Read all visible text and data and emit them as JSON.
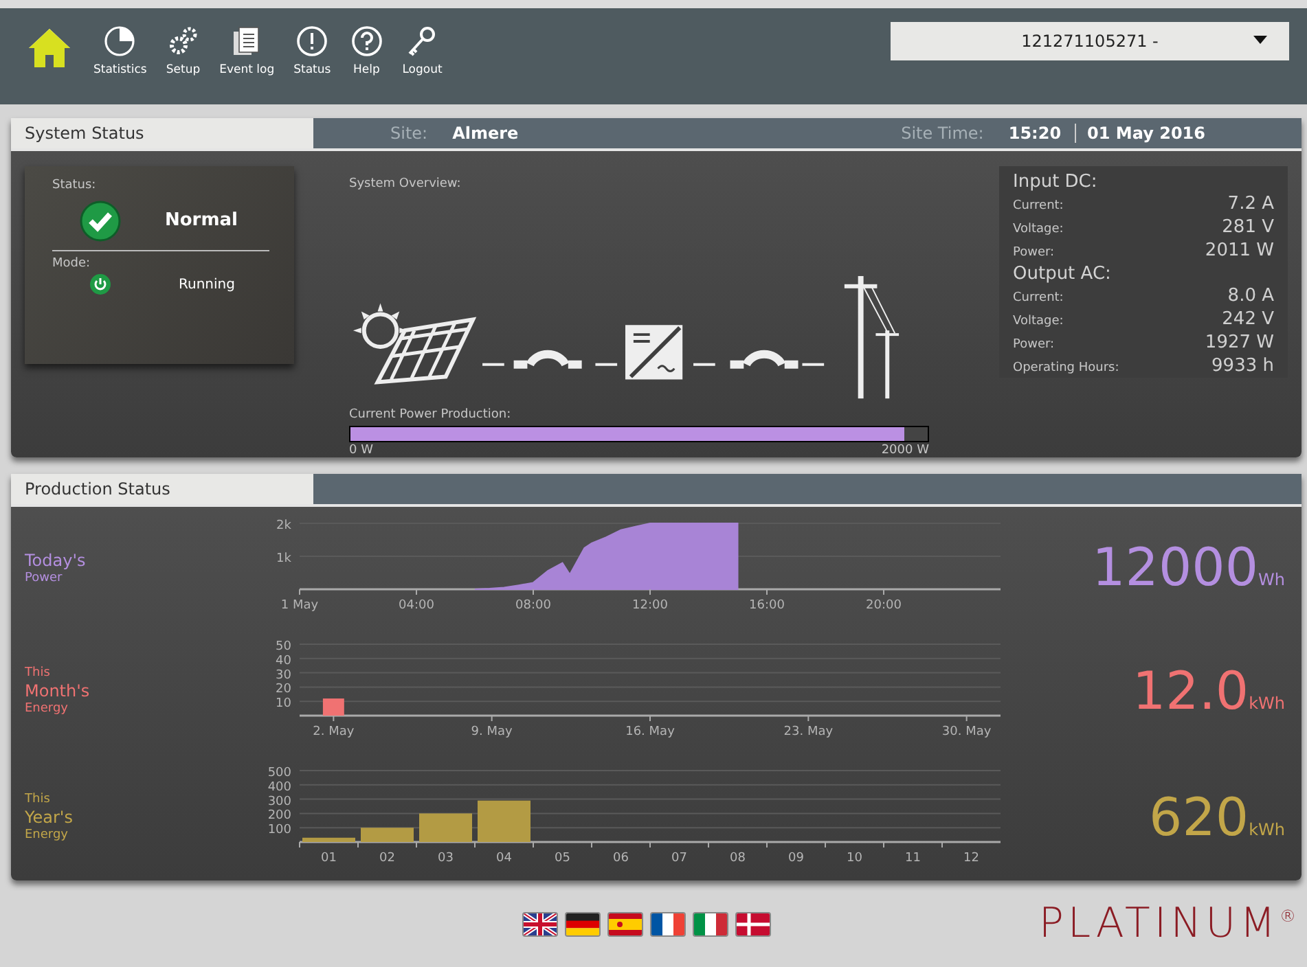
{
  "nav": [
    {
      "kind": "home",
      "selected": true
    },
    {
      "kind": "chart",
      "label": "Statistics",
      "selected": false
    },
    {
      "kind": "gears",
      "label": "Setup",
      "selected": false
    },
    {
      "kind": "document",
      "label": "Event log",
      "selected": false
    },
    {
      "kind": "alert",
      "label": "Status",
      "selected": false
    },
    {
      "kind": "help",
      "label": "Help",
      "selected": false
    },
    {
      "kind": "key",
      "label": "Logout",
      "selected": false
    }
  ],
  "device_select": {
    "value": "121271105271 -"
  },
  "system_status": {
    "title": "System Status",
    "site_label": "Site:",
    "site": "Almere",
    "time_label": "Site Time:",
    "time": "15:20",
    "date": "01 May 2016",
    "status_label": "Status:",
    "status": "Normal",
    "mode_label": "Mode:",
    "mode": "Running",
    "overview_label": "System Overview:",
    "production_label": "Current Power Production:",
    "power_bar": {
      "level": 0.96,
      "min": "0 W",
      "max": "2000 W"
    },
    "metric_groups": [
      {
        "heading": "Input DC:",
        "rows": [
          {
            "label": "Current:",
            "value": "7.2 A"
          },
          {
            "label": "Voltage:",
            "value": "281 V"
          },
          {
            "label": "Power:",
            "value": "2011 W"
          }
        ]
      },
      {
        "heading": "Output AC:",
        "rows": [
          {
            "label": "Current:",
            "value": "8.0 A"
          },
          {
            "label": "Voltage:",
            "value": "242 V"
          },
          {
            "label": "Power:",
            "value": "1927 W"
          },
          {
            "label": "Operating Hours:",
            "value": "9933 h"
          }
        ]
      }
    ]
  },
  "production_status": {
    "title": "Production Status",
    "rows": [
      {
        "title": "Today's",
        "subtitle": "Power",
        "value": "12000",
        "unit": "Wh",
        "color": "#b48fe0",
        "chart_data": {
          "type": "area",
          "x": [
            6,
            6.5,
            7,
            7.5,
            8,
            8.5,
            9,
            9.25,
            9.75,
            10,
            10.5,
            11,
            11.5,
            12,
            13,
            14,
            15
          ],
          "grid": true,
          "series": [
            {
              "color": "#a884d6",
              "values": [
                0,
                20,
                50,
                120,
                200,
                560,
                800,
                450,
                1250,
                1400,
                1580,
                1800,
                1900,
                2000,
                2000,
                2000,
                2000
              ]
            }
          ],
          "xlim": [
            0,
            24
          ],
          "ylim": [
            0,
            2000
          ],
          "xticks": [
            {
              "value": 0,
              "label": "1 May"
            },
            {
              "value": 4,
              "label": "04:00"
            },
            {
              "value": 8,
              "label": "08:00"
            },
            {
              "value": 12,
              "label": "12:00"
            },
            {
              "value": 16,
              "label": "16:00"
            },
            {
              "value": 20,
              "label": "20:00"
            }
          ],
          "yticks": [
            {
              "value": 1000,
              "label": "1k"
            },
            {
              "value": 2000,
              "label": "2k"
            }
          ]
        }
      },
      {
        "prefix": "This",
        "title": "Month's",
        "subtitle": "Energy",
        "value": "12.0",
        "unit": "kWh",
        "color": "#f07272",
        "chart_data": {
          "type": "bar",
          "grid": true,
          "categories": [
            null,
            "2. May",
            null,
            null,
            null,
            null,
            null,
            null,
            "9. May",
            null,
            null,
            null,
            null,
            null,
            null,
            "16. May",
            null,
            null,
            null,
            null,
            null,
            null,
            "23. May",
            null,
            null,
            null,
            null,
            null,
            null,
            "30. May",
            null
          ],
          "series": [
            {
              "color": "#f07272",
              "values": [
                null,
                12,
                null,
                null,
                null,
                null,
                null,
                null,
                null,
                null,
                null,
                null,
                null,
                null,
                null,
                null,
                null,
                null,
                null,
                null,
                null,
                null,
                null,
                null,
                null,
                null,
                null,
                null,
                null,
                null,
                null
              ]
            }
          ],
          "ylim": [
            0,
            50
          ],
          "yticks": [
            10,
            20,
            30,
            40,
            50
          ]
        }
      },
      {
        "prefix": "This",
        "title": "Year's",
        "subtitle": "Energy",
        "value": "620",
        "unit": "kWh",
        "color": "#c2a649",
        "chart_data": {
          "type": "bar",
          "grid": true,
          "categories": [
            "01",
            "02",
            "03",
            "04",
            "05",
            "06",
            "07",
            "08",
            "09",
            "10",
            "11",
            "12"
          ],
          "series": [
            {
              "color": "#b39b44",
              "values": [
                30,
                100,
                200,
                290,
                null,
                null,
                null,
                null,
                null,
                null,
                null,
                null
              ]
            }
          ],
          "ylim": [
            0,
            500
          ],
          "yticks": [
            100,
            200,
            300,
            400,
            500
          ]
        }
      }
    ]
  },
  "languages": [
    {
      "kind": "gb"
    },
    {
      "kind": "de"
    },
    {
      "kind": "es"
    },
    {
      "kind": "fr"
    },
    {
      "kind": "it"
    },
    {
      "kind": "dk"
    }
  ],
  "logo": {
    "text": "PLATINUM$^{®}$"
  }
}
